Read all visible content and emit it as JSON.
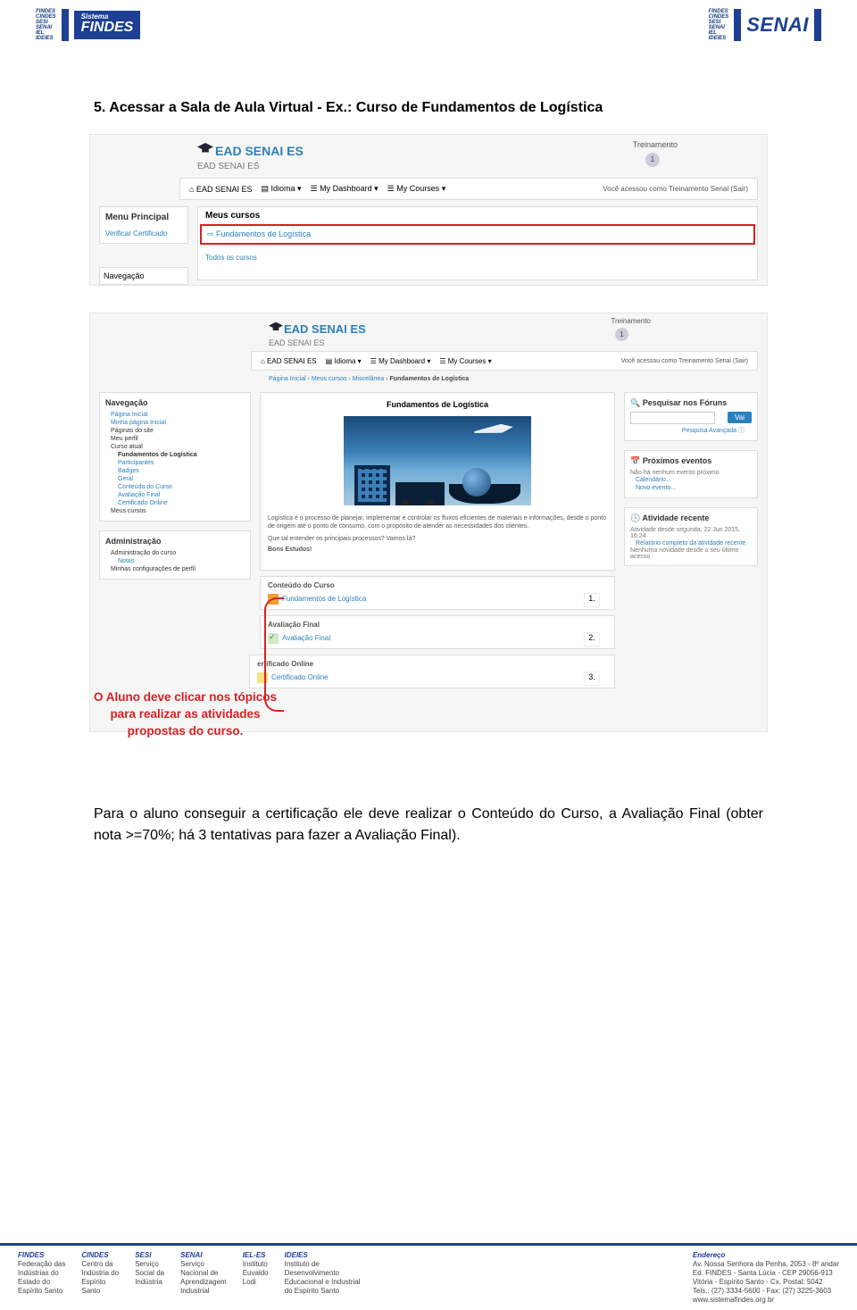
{
  "header": {
    "left_tiny": [
      "FINDES",
      "CINDES",
      "SESI",
      "SENAI",
      "IEL",
      "IDEIES"
    ],
    "findes_small": "Sistema",
    "findes_big": "FINDES",
    "right_tiny": [
      "FINDES",
      "CINDES",
      "SESI",
      "SENAI",
      "IEL",
      "IDEIES"
    ],
    "senai": "SENAI"
  },
  "heading": "5.  Acessar a Sala de Aula Virtual - Ex.: Curso de Fundamentos de Logística",
  "ss1": {
    "ead_title": "EAD SENAI ES",
    "ead_sub": "EAD SENAI ES",
    "trein": "Treinamento",
    "trein_count": "1",
    "nav": {
      "home": "⌂ EAD SENAI ES",
      "lang": "▤ Idioma ▾",
      "dash": "☰ My Dashboard ▾",
      "courses": "☰ My Courses ▾",
      "logged": "Você acessou como Treinamento Senai (Sair)"
    },
    "menu_title": "Menu Principal",
    "menu_link": "Verificar Certificado",
    "nav_title": "Navegação",
    "main_title": "Meus cursos",
    "course_link": "Fundamentos de Logística",
    "todos": "Todos os cursos"
  },
  "ss2": {
    "ead_title": "EAD SENAI ES",
    "ead_sub": "EAD SENAI ES",
    "trein": "Treinamento",
    "trein_count": "1",
    "nav": {
      "home": "⌂ EAD SENAI ES",
      "lang": "▤ Idioma ▾",
      "dash": "☰ My Dashboard ▾",
      "courses": "☰ My Courses ▾",
      "logged": "Você acessou como Treinamento Senai (Sair)"
    },
    "crumbs": [
      "Página Inicial",
      "Meus cursos",
      "Miscelânea",
      "Fundamentos de Logística"
    ],
    "left_nav": {
      "title": "Navegação",
      "rows": [
        "Página Inicial",
        "Minha página Inicial",
        "Páginas do site",
        "Meu perfil",
        "Curso atual",
        "Fundamentos de Logística",
        "Participantes",
        "Badges",
        "Geral",
        "Conteúdo do Curso",
        "Avaliação Final",
        "Certificado Online",
        "Meus cursos"
      ]
    },
    "left_admin": {
      "title": "Administração",
      "rows": [
        "Administração do curso",
        "Notas",
        "Minhas configurações de perfil"
      ]
    },
    "right_search": {
      "title": "Pesquisar nos Fóruns",
      "btn": "Vai",
      "adv": "Pesquisa Avançada ⓘ"
    },
    "right_events": {
      "title": "Próximos eventos",
      "text": "Não há nenhum evento próximo",
      "l1": "Calendário...",
      "l2": "Novo evento..."
    },
    "right_activity": {
      "title": "Atividade recente",
      "text": "Atividade desde segunda, 22 Jun 2015, 16:24",
      "l1": "Relatório completo da atividade recente",
      "l2": "Nenhuma novidade desde o seu último acesso"
    },
    "mid": {
      "ctitle": "Fundamentos de Logística",
      "desc": "Logística é o processo de planejar, implementar e controlar os fluxos eficientes de materiais e informações, desde o ponto de origem até o ponto de consumo, com o propósito de atender as necessidades dos clientes.",
      "desc2": "Que tal entender os principais processos? Vamos lá?",
      "bons": "Bons Estudos!"
    },
    "sec1": {
      "title": "Conteúdo do Curso",
      "item": "Fundamentos de Logística",
      "num": "1."
    },
    "sec2": {
      "title": "Avaliação Final",
      "item": "Avaliação Final",
      "num": "2."
    },
    "sec3": {
      "title": "ertificado Online",
      "item": "Certificado Online",
      "num": "3."
    }
  },
  "red_caption": "O Aluno deve clicar nos tópicos para realizar as atividades propostas do curso.",
  "para": "Para o aluno conseguir a certificação ele deve realizar o Conteúdo do Curso, a Avaliação Final (obter nota >=70%; há 3 tentativas para fazer a Avaliação Final).",
  "footer": {
    "findes": {
      "h": "FINDES",
      "l": [
        "Federação das",
        "Indústrias do",
        "Estado do",
        "Espírito Santo"
      ]
    },
    "cindes": {
      "h": "CINDES",
      "l": [
        "Centro da",
        "Indústria do",
        "Espírito",
        "Santo"
      ]
    },
    "sesi": {
      "h": "SESI",
      "l": [
        "Serviço",
        "Social da",
        "Indústria"
      ]
    },
    "senai": {
      "h": "SENAI",
      "l": [
        "Serviço",
        "Nacional de",
        "Aprendizagem",
        "Industrial"
      ]
    },
    "iel": {
      "h": "IEL-ES",
      "l": [
        "Instituto",
        "Euvaldo",
        "Lodi"
      ]
    },
    "ideies": {
      "h": "IDEIES",
      "l": [
        "Instituto de",
        "Desenvolvimento",
        "Educacional e Industrial",
        "do Espírito Santo"
      ]
    },
    "addr": {
      "h": "Endereço",
      "l": [
        "Av. Nossa Senhora da Penha, 2053 - 8º andar",
        "Ed. FINDES - Santa Lúcia - CEP 29056-913",
        "Vitória - Espírito Santo - Cx. Postal: 5042",
        "Tels.: (27) 3334-5600 - Fax: (27) 3225-3603",
        "www.sistemafindes.org.br"
      ]
    }
  }
}
